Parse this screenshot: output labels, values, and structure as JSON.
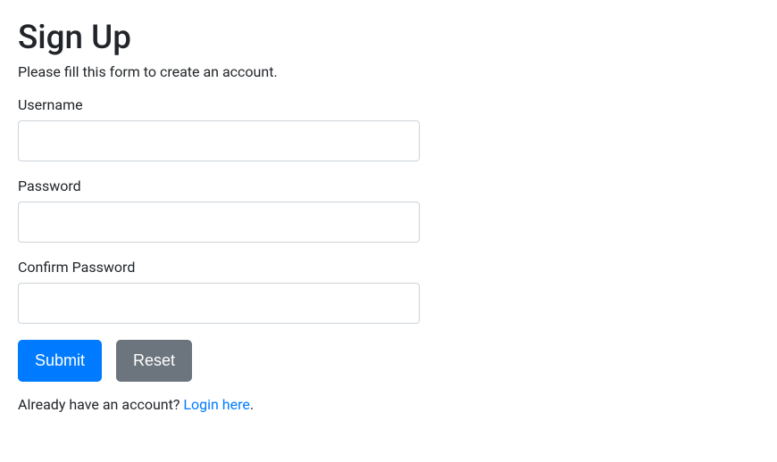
{
  "title": "Sign Up",
  "subtitle": "Please fill this form to create an account.",
  "fields": {
    "username": {
      "label": "Username",
      "value": ""
    },
    "password": {
      "label": "Password",
      "value": ""
    },
    "confirm_password": {
      "label": "Confirm Password",
      "value": ""
    }
  },
  "buttons": {
    "submit": "Submit",
    "reset": "Reset"
  },
  "footer": {
    "text": "Already have an account? ",
    "link_text": "Login here",
    "suffix": "."
  }
}
